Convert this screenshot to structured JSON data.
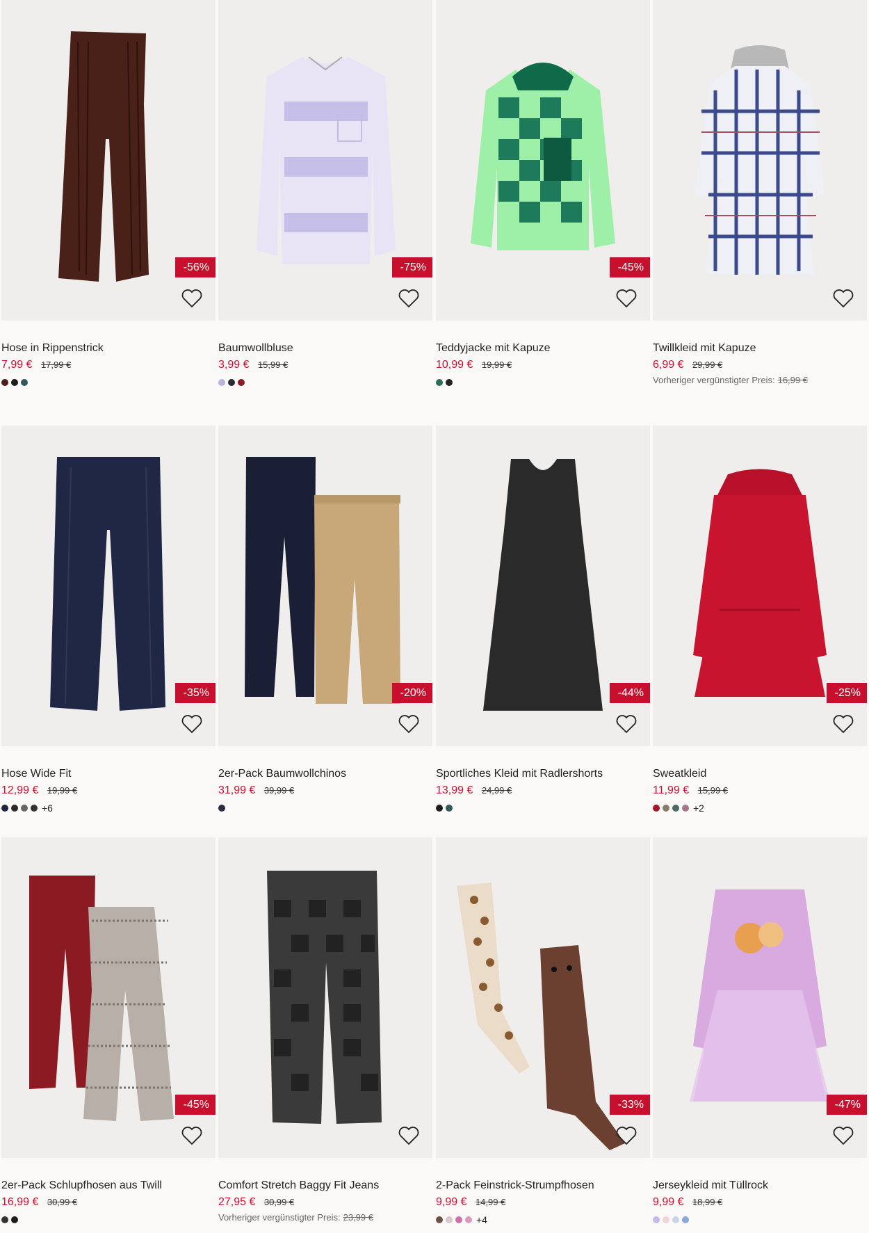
{
  "colors": {
    "sale_red": "#c8102e",
    "image_bg": "#efeeec",
    "page_bg": "#faf9f8"
  },
  "products": [
    {
      "name": "Hose in Rippenstrick",
      "price": "7,99 €",
      "old_price": "17,99 €",
      "discount": "-56%",
      "swatches": [
        "#4a2118",
        "#1c1c1c",
        "#2f5a5a"
      ],
      "more": "",
      "prev_label": "",
      "prev_value": ""
    },
    {
      "name": "Baumwollbluse",
      "price": "3,99 €",
      "old_price": "15,99 €",
      "discount": "-75%",
      "swatches": [
        "#b8b4dc",
        "#2a2a30",
        "#8b1a2a"
      ],
      "more": "",
      "prev_label": "",
      "prev_value": ""
    },
    {
      "name": "Teddyjacke mit Kapuze",
      "price": "10,99 €",
      "old_price": "19,99 €",
      "discount": "-45%",
      "swatches": [
        "#2f6b5a",
        "#222"
      ],
      "more": "",
      "prev_label": "",
      "prev_value": ""
    },
    {
      "name": "Twillkleid mit Kapuze",
      "price": "6,99 €",
      "old_price": "29,99 €",
      "discount": "",
      "swatches": [],
      "more": "",
      "prev_label": "Vorheriger vergünstigter Preis:",
      "prev_value": "16,99 €"
    },
    {
      "name": "Hose Wide Fit",
      "price": "12,99 €",
      "old_price": "19,99 €",
      "discount": "-35%",
      "swatches": [
        "#1f2340",
        "#2a2a2a",
        "#666",
        "#333"
      ],
      "more": "+6",
      "prev_label": "",
      "prev_value": ""
    },
    {
      "name": "2er-Pack Baumwollchinos",
      "price": "31,99 €",
      "old_price": "39,99 €",
      "discount": "-20%",
      "swatches": [
        "#2a2d40"
      ],
      "more": "",
      "prev_label": "",
      "prev_value": ""
    },
    {
      "name": "Sportliches Kleid mit Radlershorts",
      "price": "13,99 €",
      "old_price": "24,99 €",
      "discount": "-44%",
      "swatches": [
        "#1c1c1c",
        "#2f5a55"
      ],
      "more": "",
      "prev_label": "",
      "prev_value": ""
    },
    {
      "name": "Sweatkleid",
      "price": "11,99 €",
      "old_price": "15,99 €",
      "discount": "-25%",
      "swatches": [
        "#a3162a",
        "#8a7a6a",
        "#4a6a66",
        "#a07888"
      ],
      "more": "+2",
      "prev_label": "",
      "prev_value": ""
    },
    {
      "name": "2er-Pack Schlupfhosen aus Twill",
      "price": "16,99 €",
      "old_price": "30,99 €",
      "discount": "-45%",
      "swatches": [
        "#333",
        "#1c1c1c"
      ],
      "more": "",
      "prev_label": "",
      "prev_value": ""
    },
    {
      "name": "Comfort Stretch Baggy Fit Jeans",
      "price": "27,95 €",
      "old_price": "30,99 €",
      "discount": "",
      "swatches": [],
      "more": "",
      "prev_label": "Vorheriger vergünstigter Preis:",
      "prev_value": "23,99 €"
    },
    {
      "name": "2-Pack Feinstrick-Strumpfhosen",
      "price": "9,99 €",
      "old_price": "14,99 €",
      "discount": "-33%",
      "swatches": [
        "#6b5046",
        "#d8c6c8",
        "#d070a8",
        "#d89ab8"
      ],
      "more": "+4",
      "prev_label": "",
      "prev_value": ""
    },
    {
      "name": "Jerseykleid mit Tüllrock",
      "price": "9,99 €",
      "old_price": "18,99 €",
      "discount": "-47%",
      "swatches": [
        "#c8b8e8",
        "#f0d4dc",
        "#c8d4e8",
        "#8aa8d8"
      ],
      "more": "",
      "prev_label": "",
      "prev_value": ""
    }
  ]
}
